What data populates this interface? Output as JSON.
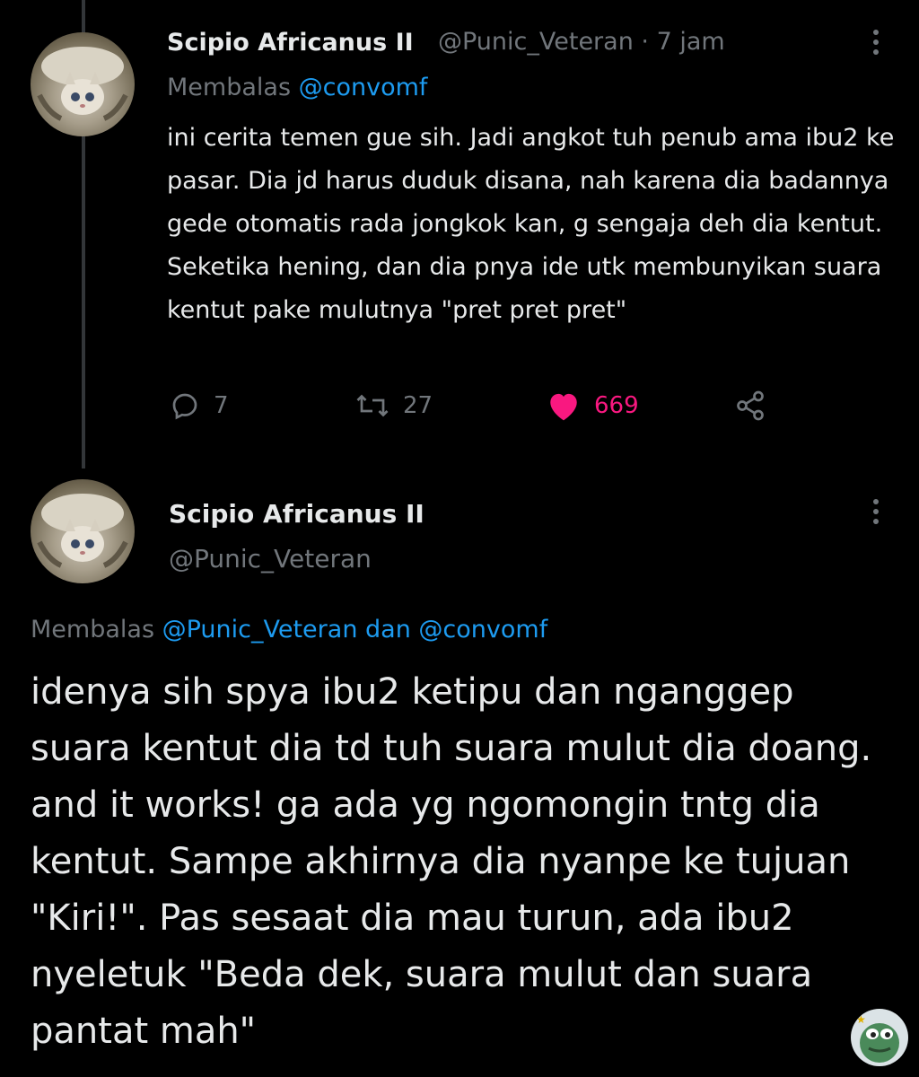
{
  "tweet1": {
    "display_name": "Scipio Africanus II",
    "handle": "@Punic_Veteran",
    "separator": "·",
    "time": "7 jam",
    "replying_prefix": "Membalas",
    "replying_to": "@convomf",
    "text": "ini cerita temen gue sih. Jadi angkot tuh penub ama ibu2 ke pasar. Dia jd harus duduk disana, nah karena dia badannya gede otomatis rada jongkok kan, g sengaja deh dia kentut. Seketika hening, dan dia pnya ide utk membunyikan suara kentut pake mulutnya \"pret pret pret\"",
    "actions": {
      "reply_count": "7",
      "retweet_count": "27",
      "like_count": "669"
    }
  },
  "tweet2": {
    "display_name": "Scipio Africanus II",
    "handle": "@Punic_Veteran",
    "replying_prefix": "Membalas",
    "replying_to_1": "@Punic_Veteran",
    "replying_conj": "dan",
    "replying_to_2": "@convomf",
    "text": "idenya sih spya ibu2 ketipu dan nganggep suara kentut dia td tuh suara mulut dia doang. and it works! ga ada yg ngomongin tntg dia kentut. Sampe akhirnya dia nyanpe ke tujuan \"Kiri!\". Pas sesaat dia mau turun, ada ibu2 nyeletuk \"Beda dek, suara mulut dan suara pantat mah\""
  },
  "colors": {
    "background": "#000000",
    "text_primary": "#e7e9ea",
    "text_secondary": "#71767b",
    "link": "#1d9bf0",
    "like": "#f91880"
  },
  "icons": [
    "reply-icon",
    "retweet-icon",
    "like-heart-icon",
    "share-icon",
    "more-options-icon"
  ]
}
